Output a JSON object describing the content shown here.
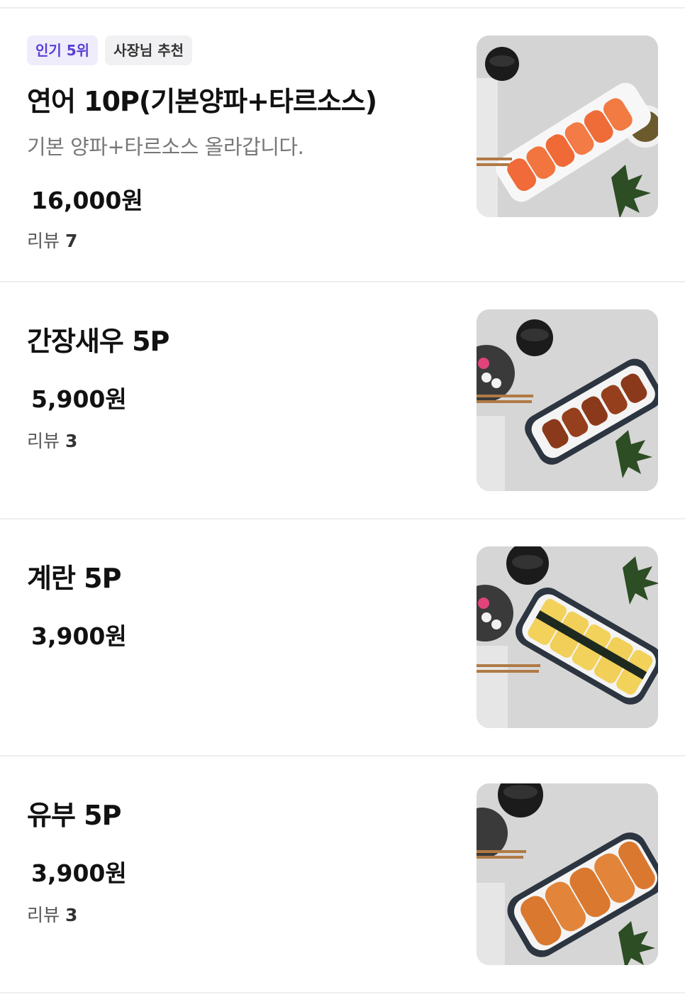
{
  "menu": {
    "items": [
      {
        "badges": [
          "인기 5위",
          "사장님 추천"
        ],
        "name": "연어 10P(기본양파+타르소스)",
        "description": "기본 양파+타르소스 올라갑니다.",
        "price": "16,000원",
        "review_label": "리뷰",
        "review_count": "7",
        "image_icon": "salmon-sushi-photo"
      },
      {
        "name": "간장새우 5P",
        "price": "5,900원",
        "review_label": "리뷰",
        "review_count": "3",
        "image_icon": "soy-shrimp-sushi-photo"
      },
      {
        "name": "계란 5P",
        "price": "3,900원",
        "image_icon": "egg-sushi-photo"
      },
      {
        "name": "유부 5P",
        "price": "3,900원",
        "review_label": "리뷰",
        "review_count": "3",
        "image_icon": "fried-tofu-sushi-photo"
      }
    ]
  },
  "colors": {
    "badge_popular_bg": "#efecfb",
    "badge_popular_text": "#5b3fd6",
    "badge_recommend_bg": "#f1f1f3",
    "divider": "#eeeeee"
  }
}
